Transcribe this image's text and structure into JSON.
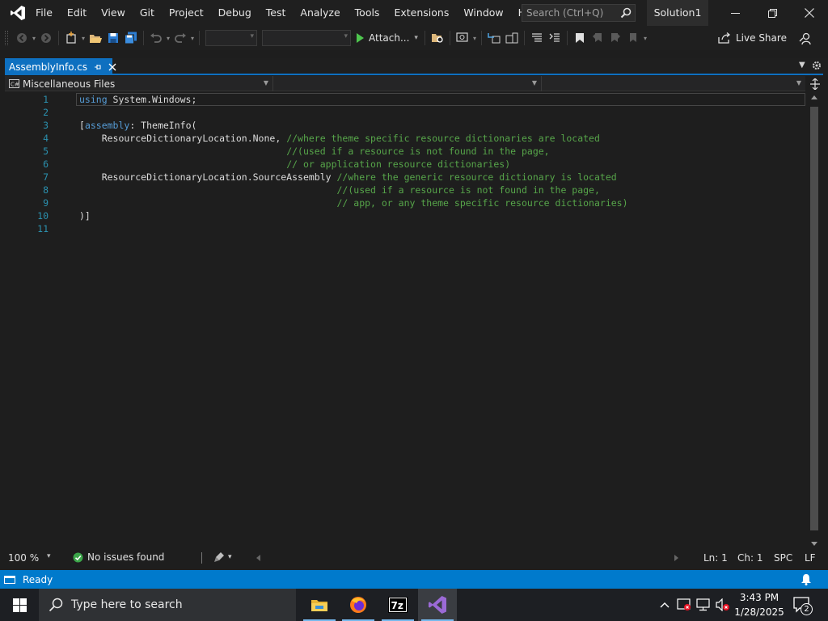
{
  "menu": [
    "File",
    "Edit",
    "View",
    "Git",
    "Project",
    "Debug",
    "Test",
    "Analyze",
    "Tools",
    "Extensions",
    "Window",
    "Help"
  ],
  "search": {
    "placeholder": "Search (Ctrl+Q)"
  },
  "solution_name": "Solution1",
  "toolbar": {
    "attach_label": "Attach...",
    "live_share_label": "Live Share"
  },
  "tab": {
    "title": "AssemblyInfo.cs"
  },
  "navbar": {
    "project": "Miscellaneous Files"
  },
  "editor": {
    "line_numbers": [
      "1",
      "2",
      "3",
      "4",
      "5",
      "6",
      "7",
      "8",
      "9",
      "10",
      "11"
    ],
    "lines": [
      {
        "n": 1,
        "segments": [
          {
            "cls": "kw",
            "text": "using"
          },
          {
            "cls": "tx",
            "text": " System.Windows;"
          }
        ]
      },
      {
        "n": 2,
        "segments": []
      },
      {
        "n": 3,
        "segments": [
          {
            "cls": "tx",
            "text": "["
          },
          {
            "cls": "kw",
            "text": "assembly"
          },
          {
            "cls": "tx",
            "text": ": ThemeInfo("
          }
        ]
      },
      {
        "n": 4,
        "segments": [
          {
            "cls": "tx",
            "text": "    ResourceDictionaryLocation.None, "
          },
          {
            "cls": "cm",
            "text": "//where theme specific resource dictionaries are located"
          }
        ]
      },
      {
        "n": 5,
        "segments": [
          {
            "cls": "tx",
            "text": "                                     "
          },
          {
            "cls": "cm",
            "text": "//(used if a resource is not found in the page,"
          }
        ]
      },
      {
        "n": 6,
        "segments": [
          {
            "cls": "tx",
            "text": "                                     "
          },
          {
            "cls": "cm",
            "text": "// or application resource dictionaries)"
          }
        ]
      },
      {
        "n": 7,
        "segments": [
          {
            "cls": "tx",
            "text": "    ResourceDictionaryLocation.SourceAssembly "
          },
          {
            "cls": "cm",
            "text": "//where the generic resource dictionary is located"
          }
        ]
      },
      {
        "n": 8,
        "segments": [
          {
            "cls": "tx",
            "text": "                                              "
          },
          {
            "cls": "cm",
            "text": "//(used if a resource is not found in the page,"
          }
        ]
      },
      {
        "n": 9,
        "segments": [
          {
            "cls": "tx",
            "text": "                                              "
          },
          {
            "cls": "cm",
            "text": "// app, or any theme specific resource dictionaries)"
          }
        ]
      },
      {
        "n": 10,
        "segments": [
          {
            "cls": "tx",
            "text": ")]"
          }
        ]
      },
      {
        "n": 11,
        "segments": []
      }
    ]
  },
  "editor_status": {
    "zoom": "100 %",
    "issues": "No issues found",
    "line": "Ln: 1",
    "col": "Ch: 1",
    "spacing": "SPC",
    "line_ending": "LF"
  },
  "status_bar": {
    "text": "Ready"
  },
  "taskbar": {
    "search_label": "Type here to search",
    "time": "3:43 PM",
    "date": "1/28/2025",
    "notification_count": "2"
  },
  "colors": {
    "accent": "#007acc",
    "keyword": "#569cd6",
    "comment": "#57a64a",
    "line_number": "#2b91af"
  }
}
